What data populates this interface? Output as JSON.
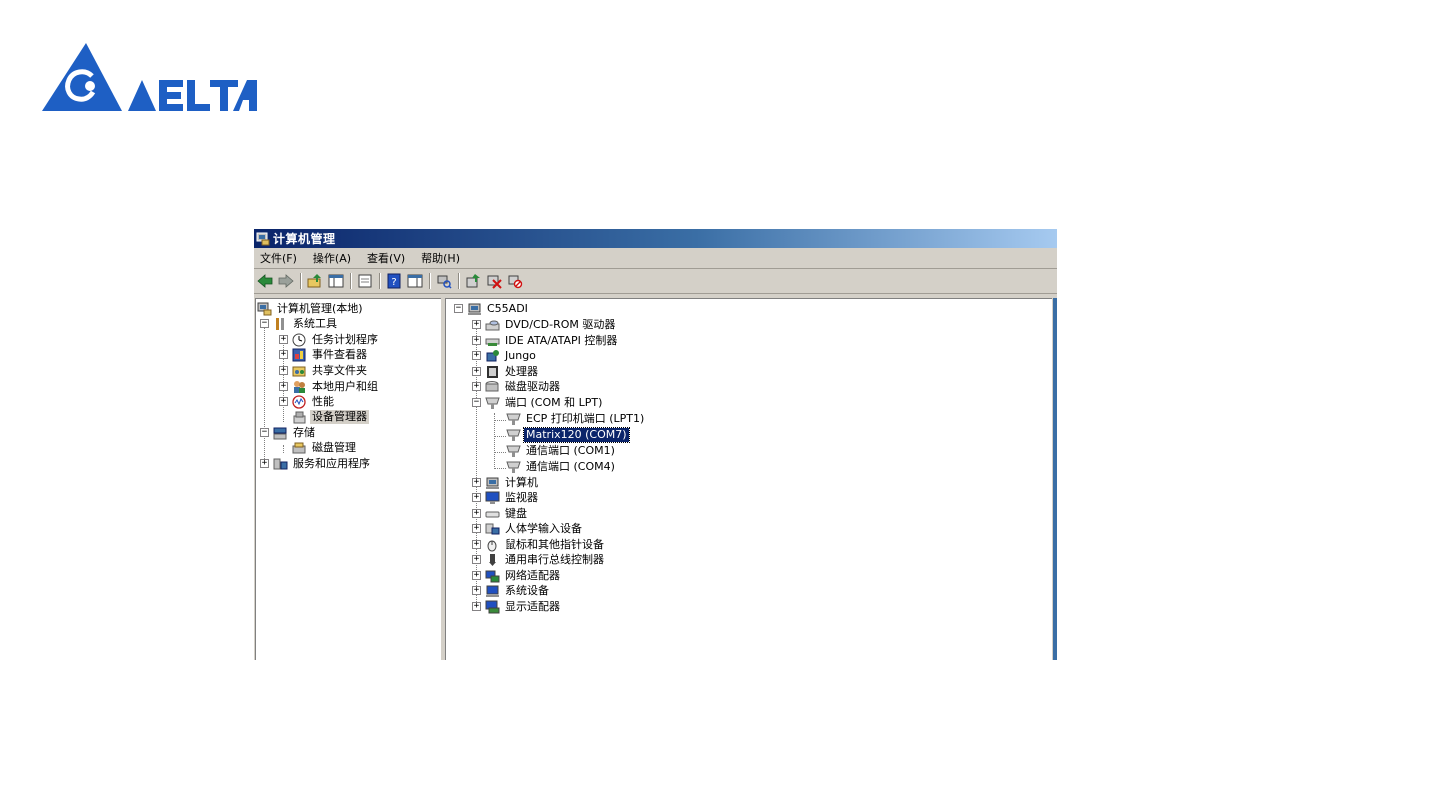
{
  "logo": {
    "text": "DELTA",
    "color": "#1e5fc4"
  },
  "window": {
    "title": "计算机管理",
    "menu": [
      {
        "label": "文件(F)"
      },
      {
        "label": "操作(A)"
      },
      {
        "label": "查看(V)"
      },
      {
        "label": "帮助(H)"
      }
    ]
  },
  "left_tree": [
    {
      "label": "计算机管理(本地)",
      "icon": "computer-management-icon"
    },
    {
      "label": "系统工具",
      "icon": "tools-icon"
    },
    {
      "label": "任务计划程序",
      "icon": "clock-icon"
    },
    {
      "label": "事件查看器",
      "icon": "event-viewer-icon"
    },
    {
      "label": "共享文件夹",
      "icon": "shared-folder-icon"
    },
    {
      "label": "本地用户和组",
      "icon": "users-icon"
    },
    {
      "label": "性能",
      "icon": "performance-icon"
    },
    {
      "label": "设备管理器",
      "icon": "device-manager-icon"
    },
    {
      "label": "存储",
      "icon": "storage-icon"
    },
    {
      "label": "磁盘管理",
      "icon": "disk-management-icon"
    },
    {
      "label": "服务和应用程序",
      "icon": "services-icon"
    }
  ],
  "right_tree": [
    {
      "label": "C55ADI",
      "icon": "computer-icon"
    },
    {
      "label": "DVD/CD-ROM 驱动器",
      "icon": "dvd-drive-icon"
    },
    {
      "label": "IDE ATA/ATAPI 控制器",
      "icon": "ide-controller-icon"
    },
    {
      "label": "Jungo",
      "icon": "jungo-icon"
    },
    {
      "label": "处理器",
      "icon": "processor-icon"
    },
    {
      "label": "磁盘驱动器",
      "icon": "disk-drive-icon"
    },
    {
      "label": "端口 (COM 和 LPT)",
      "icon": "port-icon"
    },
    {
      "label": "ECP 打印机端口 (LPT1)",
      "icon": "port-icon"
    },
    {
      "label": "Matrix120 (COM7)",
      "icon": "port-icon"
    },
    {
      "label": "通信端口 (COM1)",
      "icon": "port-icon"
    },
    {
      "label": "通信端口 (COM4)",
      "icon": "port-icon"
    },
    {
      "label": "计算机",
      "icon": "computer-icon"
    },
    {
      "label": "监视器",
      "icon": "monitor-icon"
    },
    {
      "label": "键盘",
      "icon": "keyboard-icon"
    },
    {
      "label": "人体学输入设备",
      "icon": "hid-icon"
    },
    {
      "label": "鼠标和其他指针设备",
      "icon": "mouse-icon"
    },
    {
      "label": "通用串行总线控制器",
      "icon": "usb-icon"
    },
    {
      "label": "网络适配器",
      "icon": "network-adapter-icon"
    },
    {
      "label": "系统设备",
      "icon": "system-device-icon"
    },
    {
      "label": "显示适配器",
      "icon": "display-adapter-icon"
    }
  ]
}
